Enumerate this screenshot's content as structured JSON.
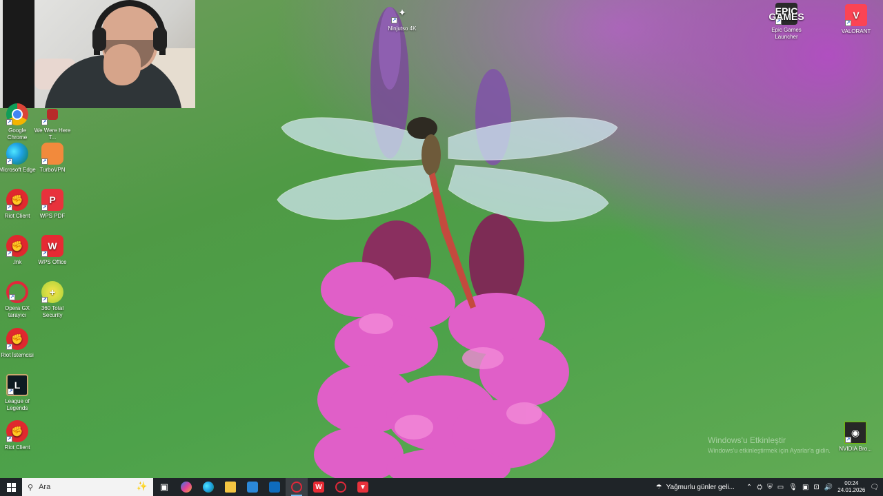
{
  "desktop": {
    "icons": [
      {
        "label": "Google Chrome",
        "icon": "chrome-icon"
      },
      {
        "label": "We Were Here T...",
        "icon": "game-icon"
      },
      {
        "label": "Microsoft Edge",
        "icon": "edge-icon"
      },
      {
        "label": "TurboVPN",
        "icon": "turbovpn-icon"
      },
      {
        "label": "Riot Client",
        "icon": "riot-icon"
      },
      {
        "label": "WPS PDF",
        "icon": "wps-pdf-icon"
      },
      {
        "label": ".lnk",
        "icon": "riot-icon"
      },
      {
        "label": "WPS Office",
        "icon": "wps-office-icon"
      },
      {
        "label": "Opera GX tarayıcı",
        "icon": "opera-icon"
      },
      {
        "label": "360 Total Security",
        "icon": "security-icon"
      },
      {
        "label": "Riot İstemcisi",
        "icon": "riot-icon"
      },
      {
        "label": "League of Legends",
        "icon": "league-icon"
      },
      {
        "label": "Riot Client",
        "icon": "riot-icon"
      },
      {
        "label": "Ninjutso 4K",
        "icon": "ninjutso-icon"
      },
      {
        "label": "Epic Games Launcher",
        "icon": "epic-icon"
      },
      {
        "label": "VALORANT",
        "icon": "valorant-icon"
      },
      {
        "label": "NVIDIA Bro...",
        "icon": "nvidia-icon"
      }
    ],
    "glyphs": {
      "wps_pdf": "P",
      "wps_office": "W",
      "plus": "+",
      "league": "L",
      "epic": "EPIC GAMES",
      "valorant": "V",
      "nvidia": "◉",
      "ninjutso": "✦"
    }
  },
  "watermark": {
    "title": "Windows'u Etkinleştir",
    "subtitle": "Windows'u etkinleştirmek için Ayarlar'a gidin."
  },
  "taskbar": {
    "search_placeholder": "Ara",
    "weather": "Yağmurlu günler geli...",
    "time": "00:24",
    "date": "24.01.2026",
    "app_glyphs": {
      "wps": "W",
      "wps_pdf": "▼"
    }
  },
  "colors": {
    "taskbar_bg": "#1f2428",
    "accent": "#76b9ed"
  }
}
